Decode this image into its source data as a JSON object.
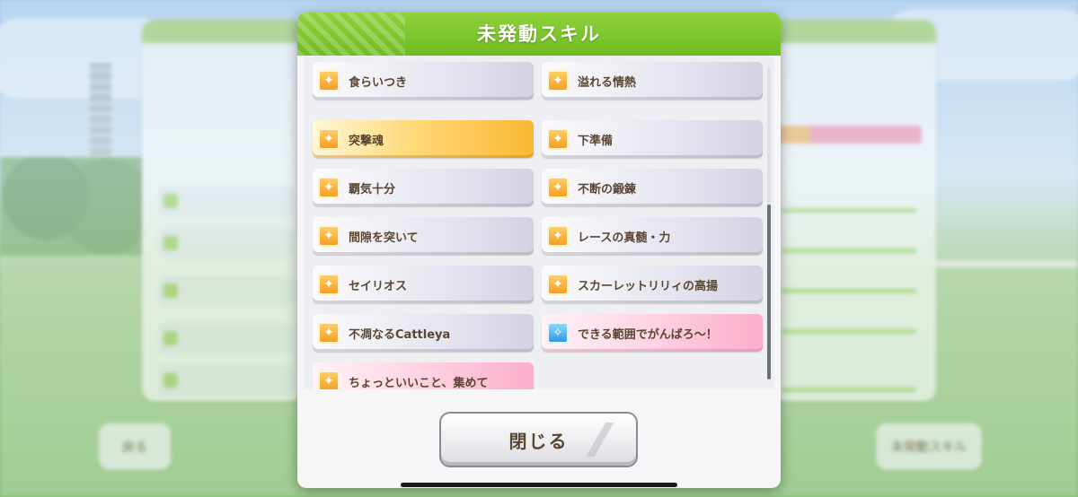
{
  "modal": {
    "title": "未発動スキル",
    "close_label": "閉じる"
  },
  "skills": [
    {
      "name": "食らいつき",
      "style": "normal",
      "icon": "gold-skill-icon"
    },
    {
      "name": "溢れる情熱",
      "style": "normal",
      "icon": "gold-skill-icon"
    },
    {
      "name": "突撃魂",
      "style": "gold",
      "icon": "gold-skill-icon"
    },
    {
      "name": "下準備",
      "style": "normal",
      "icon": "gold-skill-icon"
    },
    {
      "name": "覇気十分",
      "style": "normal",
      "icon": "gold-skill-icon"
    },
    {
      "name": "不断の鍛錬",
      "style": "normal",
      "icon": "gold-skill-icon"
    },
    {
      "name": "間隙を突いて",
      "style": "normal",
      "icon": "gold-skill-icon"
    },
    {
      "name": "レースの真髄・力",
      "style": "normal",
      "icon": "gold-skill-icon"
    },
    {
      "name": "セイリオス",
      "style": "normal",
      "icon": "gold-skill-icon"
    },
    {
      "name": "スカーレットリリィの高揚",
      "style": "normal",
      "icon": "gold-skill-icon"
    },
    {
      "name": "不凋なるCattleya",
      "style": "normal",
      "icon": "gold-skill-icon"
    },
    {
      "name": "できる範囲でがんばろ～！",
      "style": "pink",
      "icon": "blue-sparkle-icon"
    },
    {
      "name": "ちょっといいこと、集めて",
      "style": "pink",
      "icon": "gold-skill-icon"
    }
  ],
  "background": {
    "back_button": "戻る",
    "right_button": "未発動スキル"
  },
  "colors": {
    "header_green": "#7cc62c",
    "gold_highlight": "#fbb733",
    "pink_highlight": "#fbaecb",
    "text_brown": "#5a4630"
  }
}
